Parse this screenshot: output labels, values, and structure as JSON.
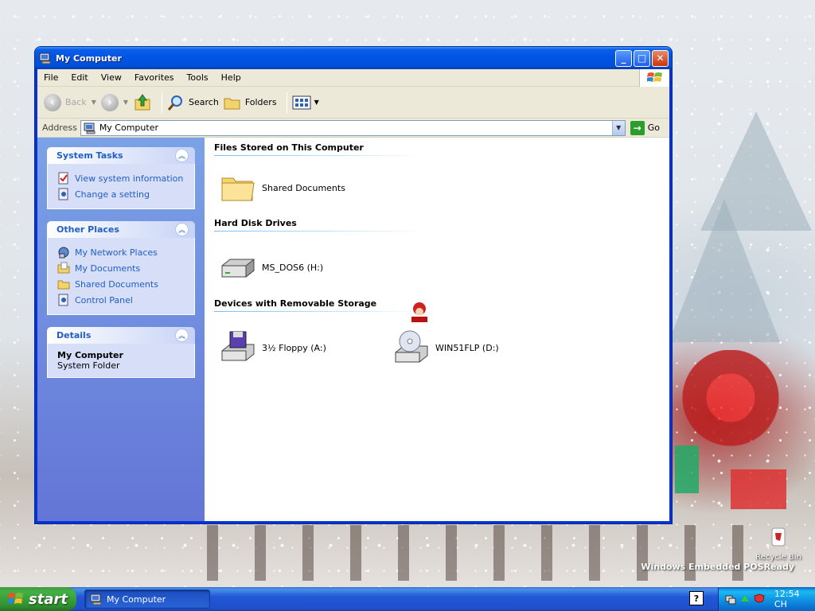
{
  "window": {
    "title": "My Computer",
    "buttons": {
      "minimize": "_",
      "maximize": "□",
      "close": "✕"
    }
  },
  "menu": {
    "items": [
      "File",
      "Edit",
      "View",
      "Favorites",
      "Tools",
      "Help"
    ]
  },
  "toolbar": {
    "back_label": "Back",
    "search_label": "Search",
    "folders_label": "Folders"
  },
  "address": {
    "label": "Address",
    "value": "My Computer",
    "go_label": "Go"
  },
  "sidebar": {
    "system_tasks": {
      "title": "System Tasks",
      "items": [
        "View system information",
        "Change a setting"
      ]
    },
    "other_places": {
      "title": "Other Places",
      "items": [
        "My Network Places",
        "My Documents",
        "Shared Documents",
        "Control Panel"
      ]
    },
    "details": {
      "title": "Details",
      "name": "My Computer",
      "type": "System Folder"
    }
  },
  "main": {
    "groups": [
      {
        "title": "Files Stored on This Computer",
        "items": [
          "Shared Documents"
        ]
      },
      {
        "title": "Hard Disk Drives",
        "items": [
          "MS_DOS6 (H:)"
        ]
      },
      {
        "title": "Devices with Removable Storage",
        "items": [
          "3½ Floppy (A:)",
          "WIN51FLP (D:)"
        ]
      }
    ]
  },
  "desktop": {
    "recycle_bin": "Recycle Bin",
    "watermark": "Windows Embedded POSReady",
    "watermark_sub": ""
  },
  "taskbar": {
    "start_label": "start",
    "task_item": "My Computer",
    "help_glyph": "?",
    "clock": "12:54 CH"
  },
  "colors": {
    "title_blue": "#0054e3",
    "sidebar_top": "#7ba2e7",
    "sidebar_bottom": "#6375d6",
    "link_blue": "#215dc6",
    "start_green": "#3c9b3c"
  }
}
